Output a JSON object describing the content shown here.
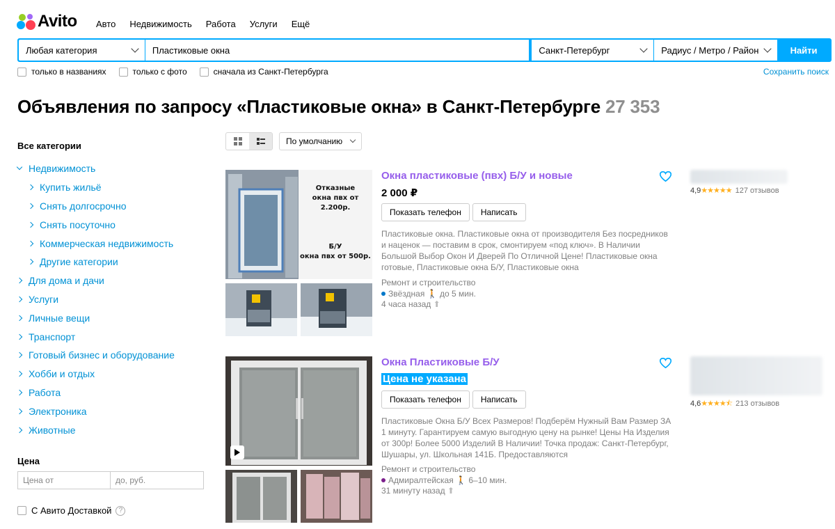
{
  "brand": {
    "logo_text": "Avito",
    "dot_colors": [
      "#00aaff",
      "#97cf26",
      "#ff4053",
      "#a169f7"
    ]
  },
  "nav": {
    "items": [
      "Авто",
      "Недвижимость",
      "Работа",
      "Услуги",
      "Ещё"
    ]
  },
  "search": {
    "category": "Любая категория",
    "query": "Пластиковые окна",
    "city": "Санкт-Петербург",
    "radius": "Радиус / Метро / Район",
    "submit": "Найти"
  },
  "filters": {
    "titles_only": "только в названиях",
    "with_photo": "только с фото",
    "city_first": "сначала из Санкт-Петербурга",
    "save_search": "Сохранить поиск"
  },
  "heading": {
    "text": "Объявления по запросу «Пластиковые окна» в Санкт-Петербурге",
    "count": "27 353"
  },
  "sidebar": {
    "title": "Все категории",
    "categories": [
      {
        "label": "Недвижимость",
        "level": 0,
        "open": true
      },
      {
        "label": "Купить жильё",
        "level": 1
      },
      {
        "label": "Снять долгосрочно",
        "level": 1
      },
      {
        "label": "Снять посуточно",
        "level": 1
      },
      {
        "label": "Коммерческая недвижимость",
        "level": 1
      },
      {
        "label": "Другие категории",
        "level": 1
      },
      {
        "label": "Для дома и дачи",
        "level": 0
      },
      {
        "label": "Услуги",
        "level": 0
      },
      {
        "label": "Личные вещи",
        "level": 0
      },
      {
        "label": "Транспорт",
        "level": 0
      },
      {
        "label": "Готовый бизнес и оборудование",
        "level": 0
      },
      {
        "label": "Хобби и отдых",
        "level": 0
      },
      {
        "label": "Работа",
        "level": 0
      },
      {
        "label": "Электроника",
        "level": 0
      },
      {
        "label": "Животные",
        "level": 0
      }
    ],
    "price_title": "Цена",
    "price_from_placeholder": "Цена от",
    "price_to_placeholder": "до, руб.",
    "delivery_label": "С Авито Доставкой"
  },
  "toolbar": {
    "sort": "По умолчанию"
  },
  "listings": [
    {
      "title": "Окна пластиковые (пвх) Б/У и новые",
      "price": "2 000 ₽",
      "price_highlight": false,
      "phone_btn": "Показать телефон",
      "write_btn": "Написать",
      "description": "Пластиковые окна. Пластиковые окна от производителя Без посредников и наценок — поставим в срок, смонтируем «под ключ». В Наличии Большой Выбор Окон И Дверей По Отличной Цене! Пластиковые окна готовые, Пластиковые окна Б/У, Пластиковые окна",
      "category": "Ремонт и строительство",
      "metro": "Звёздная",
      "metro_color": "#0078c9",
      "walk": "до 5 мин.",
      "posted": "4 часа назад",
      "rating": "4,9",
      "stars": "★★★★★",
      "reviews": "127 отзывов",
      "photo_text": [
        "Отказные",
        "окна пвх от 2.200р.",
        "Б/У",
        "окна пвх от 500р."
      ]
    },
    {
      "title": "Окна Пластиковые Б/У",
      "price": "Цена не указана",
      "price_highlight": true,
      "phone_btn": "Показать телефон",
      "write_btn": "Написать",
      "description": "Пластиковые Окна Б/У Всех Размеров! Подберём Нужный Вам Размер ЗА 1 минуту. Гарантируем самую выгодную цену на рынке! Цены На Изделия от 300р! Более 5000 Изделий В Наличии! Точка продаж: Санкт-Петербург, Шушары, ул. Школьная 141Б. Предоставляются",
      "category": "Ремонт и строительство",
      "metro": "Адмиралтейская",
      "metro_color": "#7b1f8c",
      "walk": "6–10 мин.",
      "posted": "31 минуту назад",
      "rating": "4,6",
      "stars": "★★★★⯪",
      "reviews": "213 отзывов"
    }
  ]
}
